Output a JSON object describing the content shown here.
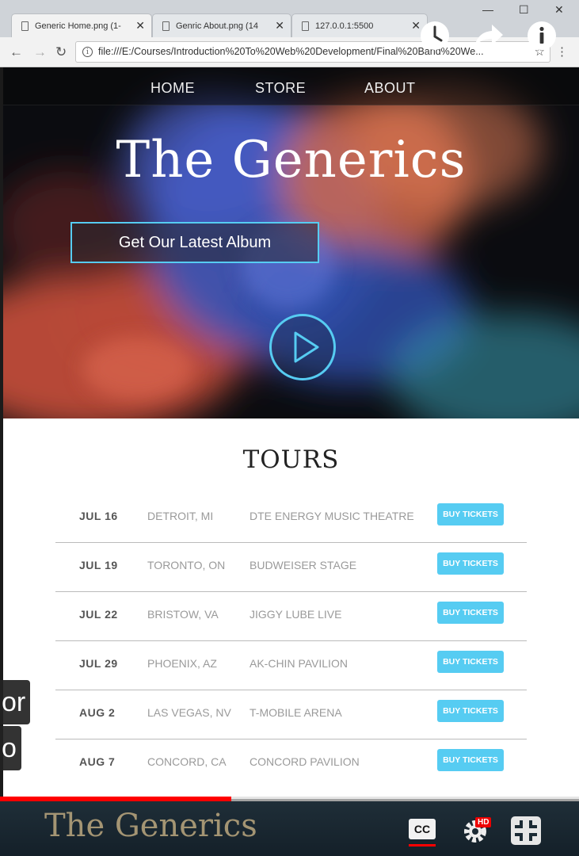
{
  "browser": {
    "tabs": [
      {
        "label": "Generic Home.png (1-",
        "active": true
      },
      {
        "label": "Genric About.png (14",
        "active": false
      },
      {
        "label": "127.0.0.1:5500",
        "active": false
      }
    ],
    "url": "file:///E:/Courses/Introduction%20To%20Web%20Development/Final%20Band%20We..."
  },
  "youtube_overlay": {
    "icons": [
      "watch-later-icon",
      "share-icon",
      "info-icon"
    ]
  },
  "site": {
    "nav": {
      "home": "HOME",
      "store": "STORE",
      "about": "ABOUT"
    },
    "band_name": "The Generics",
    "album_button": "Get Our Latest Album",
    "accent": "#56ccf2"
  },
  "tours": {
    "title": "TOURS",
    "buy_label": "BUY TICKETS",
    "rows": [
      {
        "date": "JUL 16",
        "city": "DETROIT, MI",
        "venue": "DTE ENERGY MUSIC THEATRE"
      },
      {
        "date": "JUL 19",
        "city": "TORONTO, ON",
        "venue": "BUDWEISER STAGE"
      },
      {
        "date": "JUL 22",
        "city": "BRISTOW, VA",
        "venue": "JIGGY LUBE LIVE"
      },
      {
        "date": "JUL 29",
        "city": "PHOENIX, AZ",
        "venue": "AK-CHIN PAVILION"
      },
      {
        "date": "AUG 2",
        "city": "LAS VEGAS, NV",
        "venue": "T-MOBILE ARENA"
      },
      {
        "date": "AUG 7",
        "city": "CONCORD, CA",
        "venue": "CONCORD PAVILION"
      }
    ]
  },
  "video_player": {
    "side_caption_lines": [
      "or",
      "o"
    ],
    "progress_fraction": 0.4,
    "footer_brand": "The Generics",
    "cc_label": "CC",
    "hd_label": "HD",
    "progress_color": "#ff0000"
  }
}
